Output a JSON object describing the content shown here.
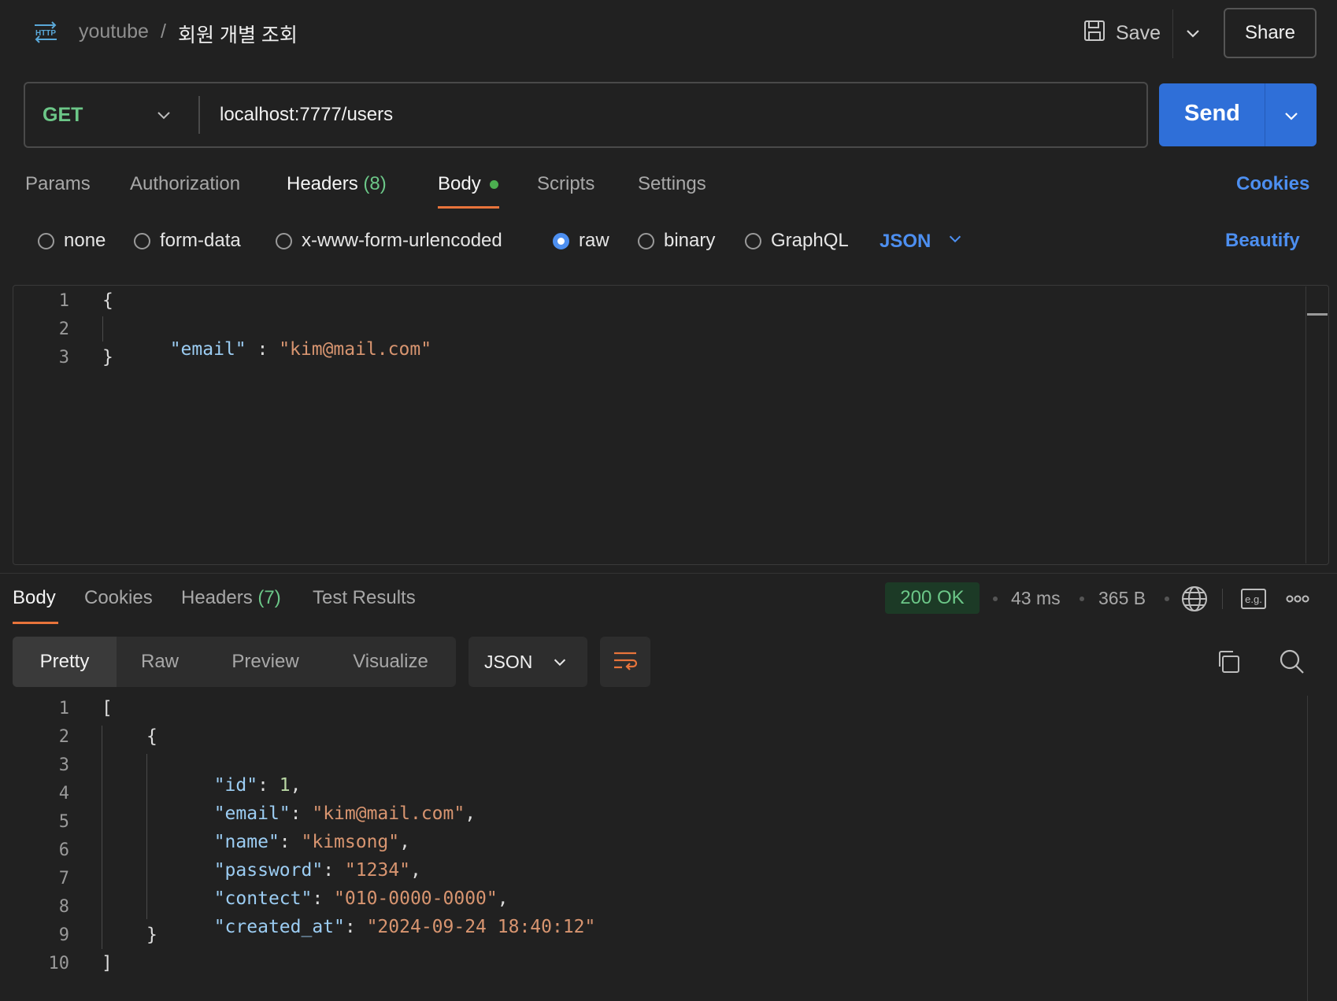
{
  "header": {
    "protocol_icon": "HTTP",
    "breadcrumb_parent": "youtube",
    "breadcrumb_sep": "/",
    "request_name": "회원 개별 조회",
    "save_label": "Save",
    "share_label": "Share"
  },
  "request": {
    "method": "GET",
    "url": "localhost:7777/users",
    "send_label": "Send"
  },
  "request_tabs": {
    "params": "Params",
    "authorization": "Authorization",
    "headers": "Headers",
    "headers_count": "(8)",
    "body": "Body",
    "scripts": "Scripts",
    "settings": "Settings",
    "cookies": "Cookies"
  },
  "body_types": {
    "none": "none",
    "form_data": "form-data",
    "urlencoded": "x-www-form-urlencoded",
    "raw": "raw",
    "binary": "binary",
    "graphql": "GraphQL",
    "format": "JSON",
    "beautify": "Beautify",
    "selected": "raw"
  },
  "request_body": {
    "line_numbers": [
      "1",
      "2",
      "3"
    ],
    "open_brace": "{",
    "close_brace": "}",
    "key": "\"email\"",
    "colon": " : ",
    "value": "\"kim@mail.com\""
  },
  "response_tabs": {
    "body": "Body",
    "cookies": "Cookies",
    "headers": "Headers",
    "headers_count": "(7)",
    "test_results": "Test Results"
  },
  "response_meta": {
    "status": "200 OK",
    "time": "43 ms",
    "size": "365 B",
    "example_icon": "e.g."
  },
  "response_view": {
    "pretty": "Pretty",
    "raw": "Raw",
    "preview": "Preview",
    "visualize": "Visualize",
    "format": "JSON"
  },
  "response_body": {
    "line_numbers": [
      "1",
      "2",
      "3",
      "4",
      "5",
      "6",
      "7",
      "8",
      "9",
      "10"
    ],
    "lb": "[",
    "rb": "]",
    "ob": "{",
    "cb": "}",
    "fields": [
      {
        "key": "\"id\"",
        "value": "1",
        "type": "number",
        "comma": ","
      },
      {
        "key": "\"email\"",
        "value": "\"kim@mail.com\"",
        "type": "string",
        "comma": ","
      },
      {
        "key": "\"name\"",
        "value": "\"kimsong\"",
        "type": "string",
        "comma": ","
      },
      {
        "key": "\"password\"",
        "value": "\"1234\"",
        "type": "string",
        "comma": ","
      },
      {
        "key": "\"contect\"",
        "value": "\"010-0000-0000\"",
        "type": "string",
        "comma": ","
      },
      {
        "key": "\"created_at\"",
        "value": "\"2024-09-24 18:40:12\"",
        "type": "string",
        "comma": ""
      }
    ]
  },
  "colors": {
    "accent": "#2f6fd8",
    "method_green": "#6cc788",
    "link_blue": "#4d8ff0",
    "json_key": "#9ccdf3",
    "json_string": "#d89570"
  }
}
